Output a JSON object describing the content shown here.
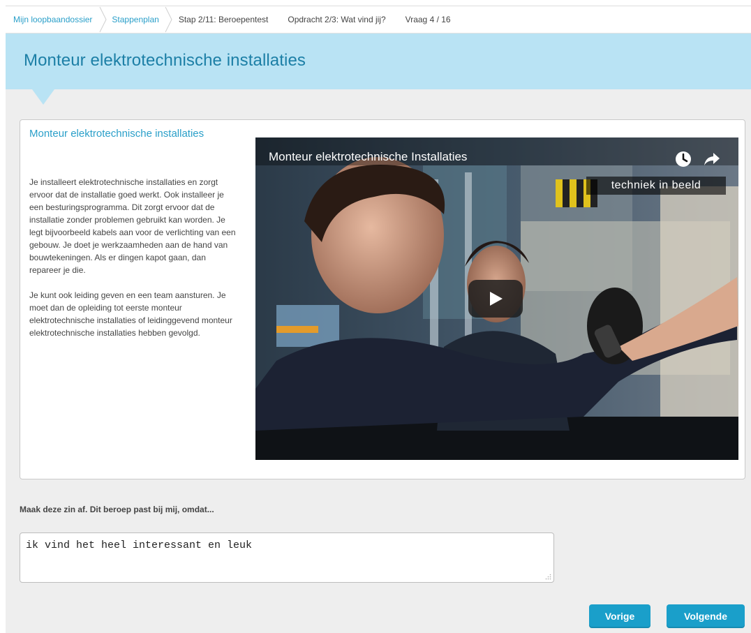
{
  "breadcrumb": {
    "items": [
      {
        "label": "Mijn loopbaandossier"
      },
      {
        "label": "Stappenplan"
      },
      {
        "label": "Stap 2/11: Beroepentest"
      },
      {
        "label": "Opdracht 2/3: Wat vind jij?"
      },
      {
        "label": "Vraag 4 / 16"
      }
    ]
  },
  "header": {
    "title": "Monteur elektrotechnische installaties"
  },
  "card": {
    "heading": "Monteur elektrotechnische installaties",
    "paragraphs": [
      "Je installeert elektrotechnische installaties en zorgt ervoor dat de installatie goed werkt. Ook installeer je een besturingsprogramma. Dit zorgt ervoor dat de installatie zonder problemen gebruikt kan worden. Je legt bijvoorbeeld kabels aan voor de verlichting van een gebouw. Je doet je werkzaamheden aan de hand van bouwtekeningen. Als er dingen kapot gaan, dan repareer je die.",
      "Je kunt ook leiding geven en een team aansturen. Je moet dan de opleiding tot eerste monteur elektrotechnische installaties of leidinggevend monteur elektrotechnische installaties hebben gevolgd."
    ]
  },
  "video": {
    "title": "Monteur elektrotechnische Installaties",
    "watermark": "techniek in beeld",
    "icons": [
      "clock-icon",
      "share-icon",
      "play-icon"
    ]
  },
  "question": {
    "prompt": "Maak deze zin af. Dit beroep past bij mij, omdat...",
    "answer": "ik vind het heel interessant en leuk"
  },
  "buttons": {
    "previous": "Vorige",
    "next": "Volgende"
  },
  "colors": {
    "accent": "#1a9fca",
    "header_band": "#b9e3f4",
    "title": "#1c7fa6",
    "link": "#2a9fc9"
  }
}
